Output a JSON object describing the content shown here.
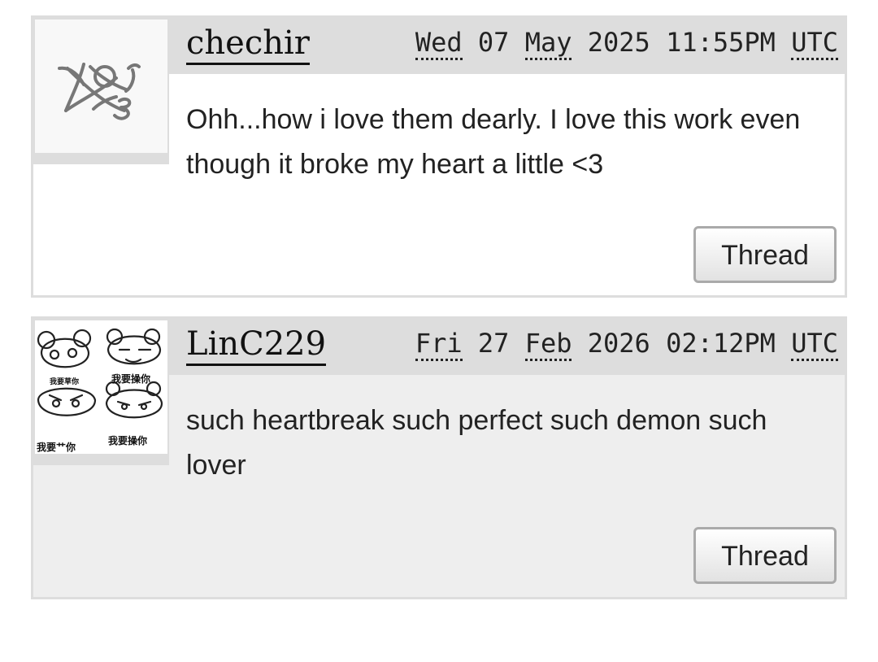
{
  "comments": [
    {
      "username": "chechir",
      "date": {
        "weekday": "Wed",
        "day": "07",
        "month": "May",
        "year": "2025",
        "time": "11:55PM",
        "tz": "UTC"
      },
      "text": "Ohh...how i love them dearly. I love this work even though it broke my heart a little <3",
      "button_label": "Thread",
      "avatar_icon": "sketch-avatar-icon"
    },
    {
      "username": "LinC229",
      "date": {
        "weekday": "Fri",
        "day": "27",
        "month": "Feb",
        "year": "2026",
        "time": "02:12PM",
        "tz": "UTC"
      },
      "text": "such heartbreak such perfect such demon such lover",
      "button_label": "Thread",
      "avatar_icon": "cartoon-bears-avatar-icon",
      "avatar_text": [
        "我要草你",
        "我要操你",
        "我要艹你",
        "我要操你"
      ]
    }
  ]
}
